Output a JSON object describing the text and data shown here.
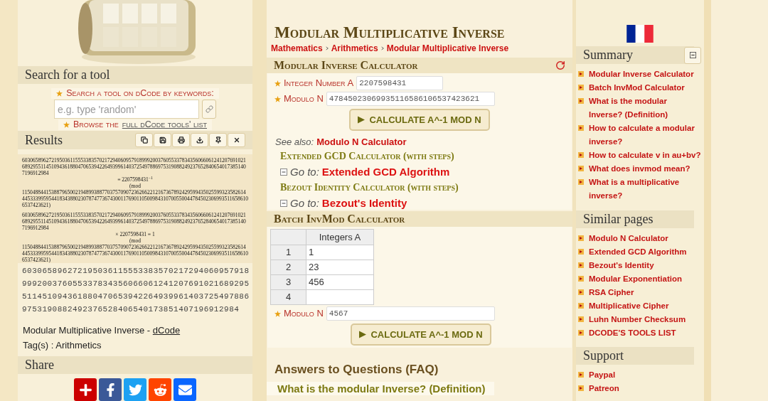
{
  "search": {
    "title": "Search for a tool",
    "label": "Search a tool on dCode by keywords:",
    "placeholder": "e.g. type 'random'",
    "browse_text": "Browse the",
    "browse_link": "full dCode tools' list"
  },
  "results": {
    "title": "Results",
    "formulas": [
      {
        "line1": "6030658962721950361155533835702172940609579189992003760553378343560660612412076910216892955114510943618804706539422649399614037254978869753190882492376528406540173851407196912984",
        "relation": "≡ 2207598431$^{−1}$",
        "mod": "(mod",
        "line2": "11504884415388796500219489938877037570907236266221216736789242959943502559932358261444533399595441834388023078747736743001176901105009843107005500447845023069935116586106537423621)"
      },
      {
        "line1": "6030658962721950361155533835702172940609579189992003760553378343560660612412076910216892955114510943618804706539422649399614037254978869753190882492376528406540173851407196912984",
        "relation": "× 2207598431 ≡ 1",
        "mod": "(mod",
        "line2": "11504884415388796500219489938877037570907236266221216736789242959943502559932358261444533399595441834388023078747736743001176901105009843107005500447845023069935116586106537423621)"
      }
    ],
    "plain": "6030658962721950361155533835702172940609579189992003760553378343560660612412076910216892955114510943618804706539422649399614037254978869753190882492376528406540173851407196912984",
    "source": "Modular Multiplicative Inverse - ",
    "source_link": "dCode",
    "tags": "Tag(s) : Arithmetics"
  },
  "share": {
    "title": "Share"
  },
  "page": {
    "title": "Modular Multiplicative Inverse",
    "breadcrumb": [
      "Mathematics",
      "Arithmetics",
      "Modular Multiplicative Inverse"
    ]
  },
  "calculator": {
    "title": "Modular Inverse Calculator",
    "fields": [
      {
        "label": "Integer Number A",
        "value": "2207598431"
      },
      {
        "label": "Modulo N",
        "value": "47845023069935116586106537423621"
      }
    ],
    "button": "CALCULATE A^-1 MOD N",
    "see_also_label": "See also:",
    "see_also_link": "Modulo N Calculator",
    "related": [
      {
        "title": "Extended GCD Calculator (with steps)",
        "goto": "Go to:",
        "link": "Extended GCD Algorithm"
      },
      {
        "title": "Bezout Identity Calculator (with steps)",
        "goto": "Go to:",
        "link": "Bezout's Identity"
      }
    ]
  },
  "batch": {
    "title": "Batch InvMod Calculator",
    "columns": [
      "Integers A"
    ],
    "rows": [
      {
        "index": "1",
        "value": "1"
      },
      {
        "index": "2",
        "value": "23"
      },
      {
        "index": "3",
        "value": "456"
      },
      {
        "index": "4"
      }
    ],
    "modulo": {
      "label": "Modulo N",
      "value": "4567"
    },
    "button": "CALCULATE A^-1 MOD N"
  },
  "faq": {
    "title": "Answers to Questions (FAQ)",
    "questions": [
      "What is the modular Inverse? (Definition)"
    ]
  },
  "summary": {
    "title": "Summary",
    "items": [
      "Modular Inverse Calculator",
      "Batch InvMod Calculator",
      "What is the modular Inverse? (Definition)",
      "How to calculate a modular inverse?",
      "How to calculate v in au+bv?",
      "What does invmod mean?",
      "What is a multiplicative inverse?"
    ]
  },
  "similar": {
    "title": "Similar pages",
    "items": [
      "Modulo N Calculator",
      "Extended GCD Algorithm",
      "Bezout's Identity",
      "Modular Exponentiation",
      "RSA Cipher",
      "Multiplicative Cipher",
      "Luhn Number Checksum",
      "DCODE'S TOOLS LIST"
    ]
  },
  "support": {
    "title": "Support",
    "items": [
      "Paypal",
      "Patreon"
    ]
  }
}
